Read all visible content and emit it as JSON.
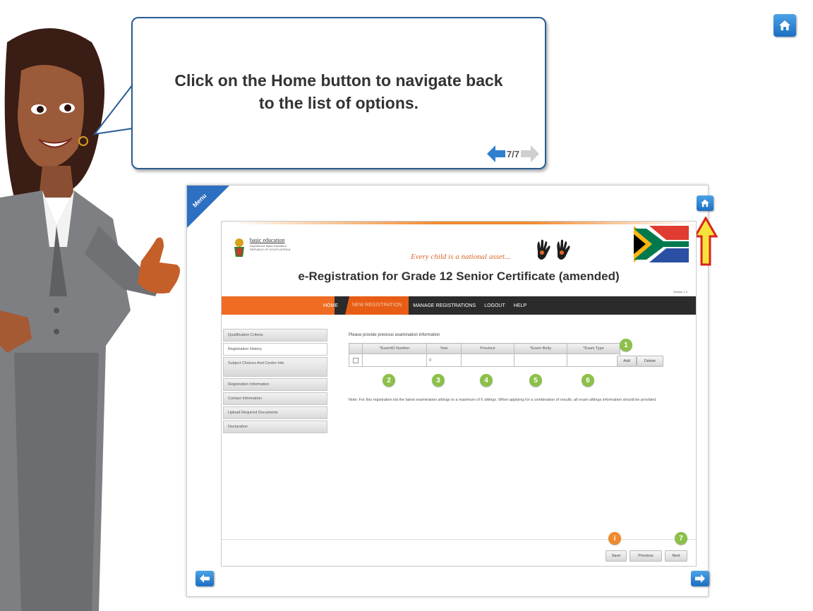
{
  "bubble": {
    "line1": "Click on the Home button to navigate back",
    "line2": "to the list of options.",
    "counter": "7/7"
  },
  "panel": {
    "menu_label": "Menu",
    "header": {
      "logo_title": "basic education",
      "logo_sub": "Department: Basic Education REPUBLIC OF SOUTH AFRICA",
      "slogan": "Every child is a national asset...",
      "app_title": "e-Registration for Grade 12 Senior Certificate (amended)",
      "tiny_link": "Version 1.0"
    },
    "nav": {
      "home": "HOME",
      "new_registration": "NEW REGISTRATION",
      "manage": "MANAGE REGISTRATIONS",
      "logout": "LOGOUT",
      "help": "HELP"
    },
    "sidebar": [
      "Qualification Criteria",
      "Registration History",
      "Subject Choices And Centre Info",
      "Registration Information",
      "Contact Information",
      "Upload Required Documents",
      "Declaration"
    ],
    "content": {
      "title": "Please provide previous examination information",
      "columns": [
        "*ExamID Number",
        "Year",
        "Province",
        "*Exam Body",
        "*Exam Type"
      ],
      "row_year_value": "0",
      "add_label": "Add",
      "delete_label": "Delete",
      "note": "Note: For this registration list the latest examination sittings to a maximum of 6 sittings. When applying for a combination of results, all exam sittings information should be provided.",
      "markers": [
        "1",
        "2",
        "3",
        "4",
        "5",
        "6"
      ]
    },
    "footer": {
      "save_label": "Save",
      "previous_label": "Previous",
      "next_label": "Next",
      "info_marker": "i",
      "next_marker": "7"
    }
  },
  "colors": {
    "accent_blue": "#1c6ec2",
    "nav_orange": "#ef6c22",
    "nav_dark": "#2b2b2b",
    "marker_green": "#8dc04a",
    "marker_orange": "#f08a2c",
    "highlight_arrow": "#f7e23a"
  },
  "icons": [
    "home-icon",
    "arrow-left-icon",
    "arrow-right-icon",
    "up-arrow-highlight-icon"
  ]
}
